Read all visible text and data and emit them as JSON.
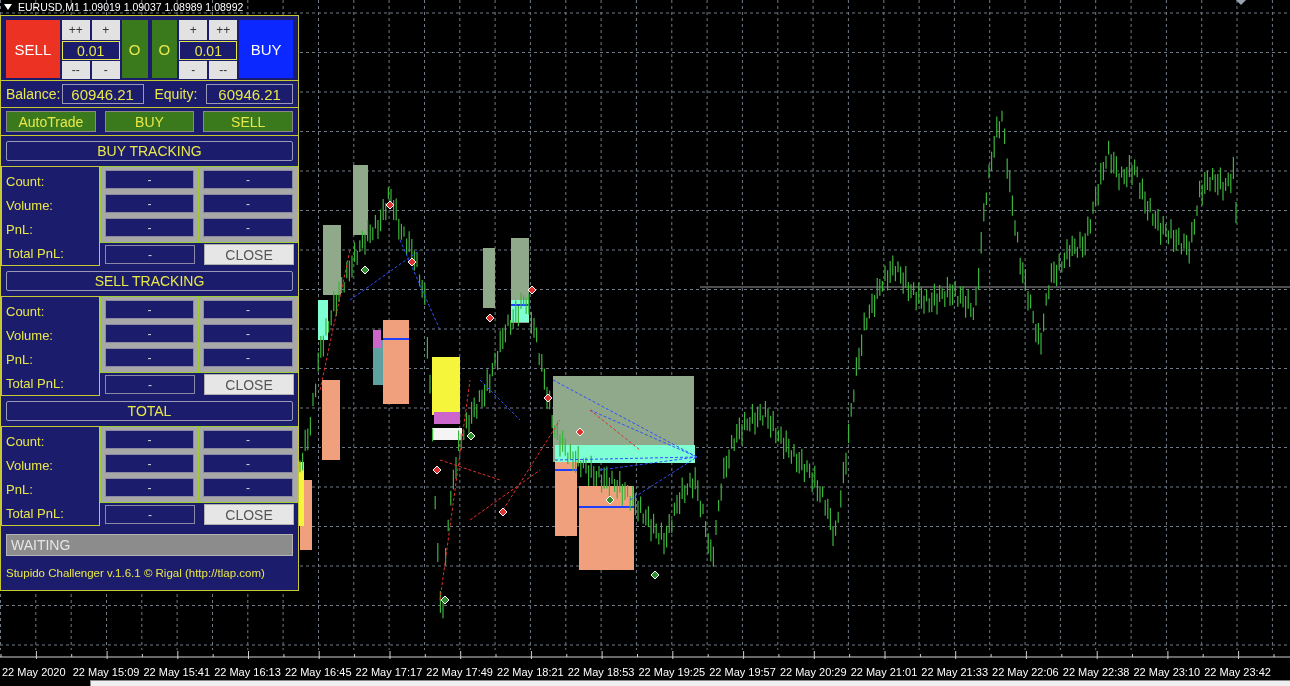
{
  "chart": {
    "title": "EURUSD,M1 1.09019 1.09037 1.08989 1.08992"
  },
  "panel": {
    "sell_button": "SELL",
    "lot_groups": [
      {
        "up": [
          "++",
          "+"
        ],
        "lot": "0.01",
        "down": [
          "--",
          "-"
        ]
      },
      {
        "up": [
          "+",
          "++"
        ],
        "lot": "0.01",
        "down": [
          "-",
          "--"
        ]
      }
    ],
    "order_buttons": [
      "O",
      "O"
    ],
    "buy_button": "BUY",
    "account": [
      {
        "label": "Balance:",
        "value": "60946.21"
      },
      {
        "label": "Equity:",
        "value": "60946.21"
      }
    ],
    "action_buttons": [
      "AutoTrade",
      "BUY",
      "SELL"
    ],
    "sections": [
      {
        "title": "BUY TRACKING",
        "rows": [
          {
            "label": "Count:",
            "values": [
              "-",
              "-"
            ]
          },
          {
            "label": "Volume:",
            "values": [
              "-",
              "-"
            ]
          },
          {
            "label": "PnL:",
            "values": [
              "-",
              "-"
            ]
          }
        ],
        "total": {
          "label": "Total PnL:",
          "value": "-"
        },
        "close_button": "CLOSE"
      },
      {
        "title": "SELL TRACKING",
        "rows": [
          {
            "label": "Count:",
            "values": [
              "-",
              "-"
            ]
          },
          {
            "label": "Volume:",
            "values": [
              "-",
              "-"
            ]
          },
          {
            "label": "PnL:",
            "values": [
              "-",
              "-"
            ]
          }
        ],
        "total": {
          "label": "Total PnL:",
          "value": "-"
        },
        "close_button": "CLOSE"
      },
      {
        "title": "TOTAL",
        "rows": [
          {
            "label": "Count:",
            "values": [
              "-",
              "-"
            ]
          },
          {
            "label": "Volume:",
            "values": [
              "-",
              "-"
            ]
          },
          {
            "label": "PnL:",
            "values": [
              "-",
              "-"
            ]
          }
        ],
        "total": {
          "label": "Total PnL:",
          "value": "-"
        },
        "close_button": "CLOSE"
      }
    ],
    "status": "WAITING",
    "footer": "Stupido Challenger v.1.6.1 © Rigal (http://tlap.com)"
  },
  "time_axis": {
    "labels": [
      "22 May 2020",
      "22 May 15:09",
      "22 May 15:41",
      "22 May 16:13",
      "22 May 16:45",
      "22 May 17:17",
      "22 May 17:49",
      "22 May 18:21",
      "22 May 18:53",
      "22 May 19:25",
      "22 May 19:57",
      "22 May 20:29",
      "22 May 21:01",
      "22 May 21:33",
      "22 May 22:06",
      "22 May 22:38",
      "22 May 23:10",
      "22 May 23:42"
    ]
  }
}
